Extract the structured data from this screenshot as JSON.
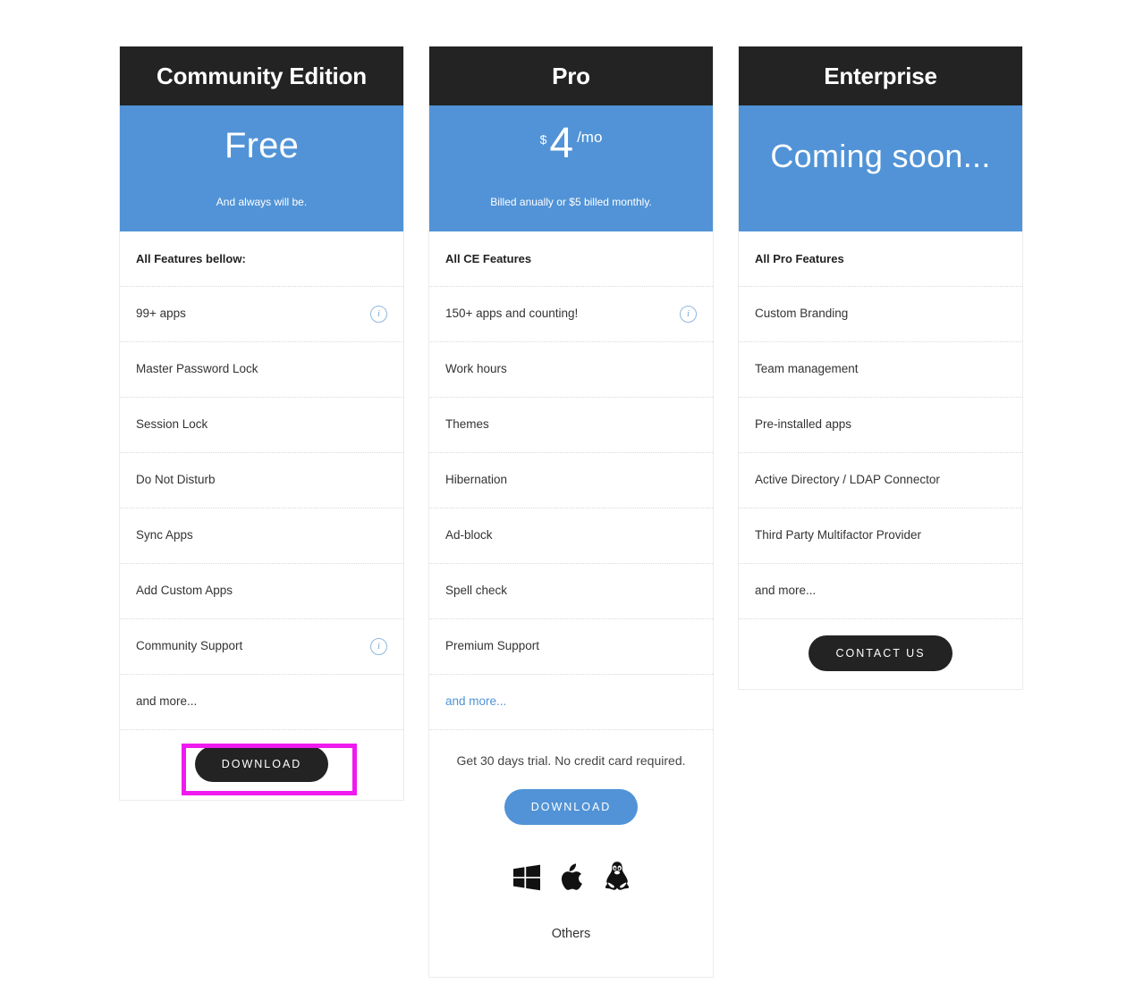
{
  "plans": [
    {
      "id": "community",
      "title": "Community Edition",
      "price_text": "Free",
      "price_note": "And always will be.",
      "price_kind": "text",
      "features": [
        {
          "label": "All Features bellow:",
          "heading": true,
          "info": false,
          "link": false
        },
        {
          "label": "99+ apps",
          "heading": false,
          "info": true,
          "link": false
        },
        {
          "label": "Master Password Lock",
          "heading": false,
          "info": false,
          "link": false
        },
        {
          "label": "Session Lock",
          "heading": false,
          "info": false,
          "link": false
        },
        {
          "label": "Do Not Disturb",
          "heading": false,
          "info": false,
          "link": false
        },
        {
          "label": "Sync Apps",
          "heading": false,
          "info": false,
          "link": false
        },
        {
          "label": "Add Custom Apps",
          "heading": false,
          "info": false,
          "link": false
        },
        {
          "label": "Community Support",
          "heading": false,
          "info": true,
          "link": false
        },
        {
          "label": "and more...",
          "heading": false,
          "info": false,
          "link": false
        }
      ],
      "cta_label": "DOWNLOAD",
      "cta_style": "dark"
    },
    {
      "id": "pro",
      "title": "Pro",
      "price_kind": "amount",
      "currency": "$",
      "amount": "4",
      "period": "/mo",
      "price_note": "Billed anually or $5 billed monthly.",
      "features": [
        {
          "label": "All CE Features",
          "heading": true,
          "info": false,
          "link": false
        },
        {
          "label": "150+ apps and counting!",
          "heading": false,
          "info": true,
          "link": false
        },
        {
          "label": "Work hours",
          "heading": false,
          "info": false,
          "link": false
        },
        {
          "label": "Themes",
          "heading": false,
          "info": false,
          "link": false
        },
        {
          "label": "Hibernation",
          "heading": false,
          "info": false,
          "link": false
        },
        {
          "label": "Ad-block",
          "heading": false,
          "info": false,
          "link": false
        },
        {
          "label": "Spell check",
          "heading": false,
          "info": false,
          "link": false
        },
        {
          "label": "Premium Support",
          "heading": false,
          "info": false,
          "link": false
        },
        {
          "label": "and more...",
          "heading": false,
          "info": false,
          "link": true
        }
      ],
      "trial_note": "Get 30 days trial. No credit card required.",
      "cta_label": "DOWNLOAD",
      "cta_style": "blue",
      "os_icons": [
        "windows-icon",
        "apple-icon",
        "linux-icon"
      ],
      "others_label": "Others"
    },
    {
      "id": "enterprise",
      "title": "Enterprise",
      "price_kind": "soon",
      "price_text": "Coming soon...",
      "price_note": "",
      "features": [
        {
          "label": "All Pro Features",
          "heading": true,
          "info": false,
          "link": false
        },
        {
          "label": "Custom Branding",
          "heading": false,
          "info": false,
          "link": false
        },
        {
          "label": "Team management",
          "heading": false,
          "info": false,
          "link": false
        },
        {
          "label": "Pre-installed apps",
          "heading": false,
          "info": false,
          "link": false
        },
        {
          "label": "Active Directory / LDAP Connector",
          "heading": false,
          "info": false,
          "link": false
        },
        {
          "label": "Third Party Multifactor Provider",
          "heading": false,
          "info": false,
          "link": false
        },
        {
          "label": "and more...",
          "heading": false,
          "info": false,
          "link": false
        }
      ],
      "cta_label": "CONTACT US",
      "cta_style": "dark"
    }
  ],
  "info_icon_glyph": "i",
  "colors": {
    "header_dark": "#232323",
    "accent_blue": "#5193d6",
    "highlight_magenta": "#ef1aef",
    "row_divider": "#d9d9d9"
  },
  "highlight": {
    "target": "community-download-button"
  }
}
